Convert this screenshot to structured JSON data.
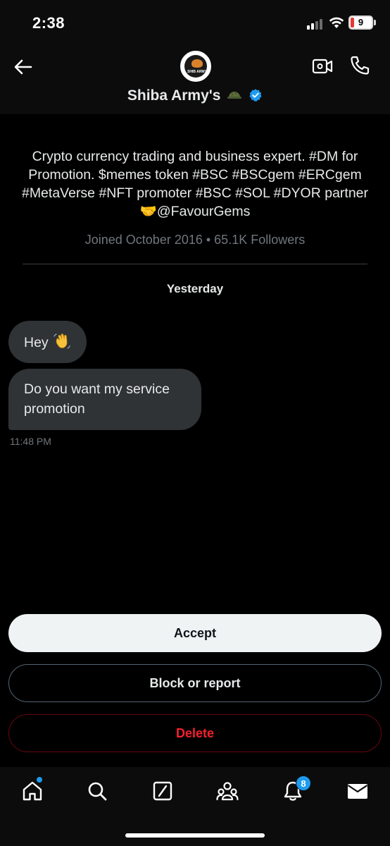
{
  "status_bar": {
    "time": "2:38",
    "battery_level": "9",
    "icons": [
      "signal-icon",
      "wifi-icon",
      "battery-icon"
    ]
  },
  "header": {
    "avatar_text": "SHIB ARMY",
    "name": "Shiba Army's",
    "verified": true,
    "icons": [
      "back-arrow-icon",
      "helmet-emoji-icon",
      "verified-badge-icon",
      "video-call-icon",
      "phone-call-icon"
    ]
  },
  "profile": {
    "bio": "Crypto currency trading and business expert. #DM for Promotion. $memes token #BSC #BSCgem #ERCgem #MetaVerse #NFT promoter #BSC #SOL #DYOR  partner🤝@FavourGems",
    "meta": "Joined October 2016 • 65.1K Followers"
  },
  "conversation": {
    "day_label": "Yesterday",
    "messages": [
      {
        "text": "Hey",
        "emoji_icon": "waving-hand-icon"
      },
      {
        "text": "Do you want my service promotion"
      }
    ],
    "timestamp": "11:48 PM"
  },
  "actions": {
    "accept_label": "Accept",
    "block_label": "Block or report",
    "delete_label": "Delete"
  },
  "bottom_nav": {
    "items": [
      "home-icon",
      "search-icon",
      "grok-icon",
      "communities-icon",
      "notifications-icon",
      "messages-icon"
    ],
    "notification_count": "8"
  },
  "colors": {
    "accent": "#1d9bf0",
    "danger": "#f4212e",
    "bubble": "#2f3336",
    "background": "#000000"
  }
}
